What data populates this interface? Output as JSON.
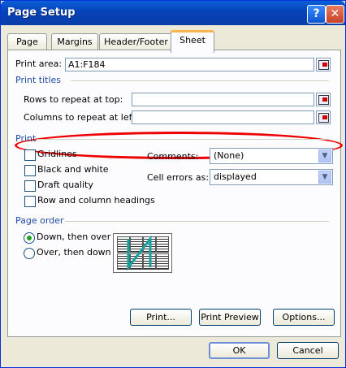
{
  "dialog": {
    "title": "Page Setup"
  },
  "titlebar": {
    "help_label": "?",
    "close_label": "✕"
  },
  "tabs": [
    {
      "label": "Page"
    },
    {
      "label": "Margins"
    },
    {
      "label": "Header/Footer"
    },
    {
      "label": "Sheet"
    }
  ],
  "sheet": {
    "print_area_label": "Print area:",
    "print_area_value": "A1:F184",
    "print_titles_heading": "Print titles",
    "rows_repeat_label": "Rows to repeat at top:",
    "rows_repeat_value": "",
    "columns_repeat_label": "Columns to repeat at left:",
    "columns_repeat_value": "",
    "print_heading": "Print",
    "gridlines": "Gridlines",
    "black_white": "Black and white",
    "draft_quality": "Draft quality",
    "row_col_headings": "Row and column headings",
    "comments_label": "Comments:",
    "comments_value": "(None)",
    "cell_errors_label": "Cell errors as:",
    "cell_errors_value": "displayed",
    "page_order_heading": "Page order",
    "down_over": "Down, then over",
    "over_down": "Over, then down"
  },
  "panel_buttons": {
    "print": "Print...",
    "print_preview": "Print Preview",
    "options": "Options..."
  },
  "footer_buttons": {
    "ok": "OK",
    "cancel": "Cancel"
  }
}
